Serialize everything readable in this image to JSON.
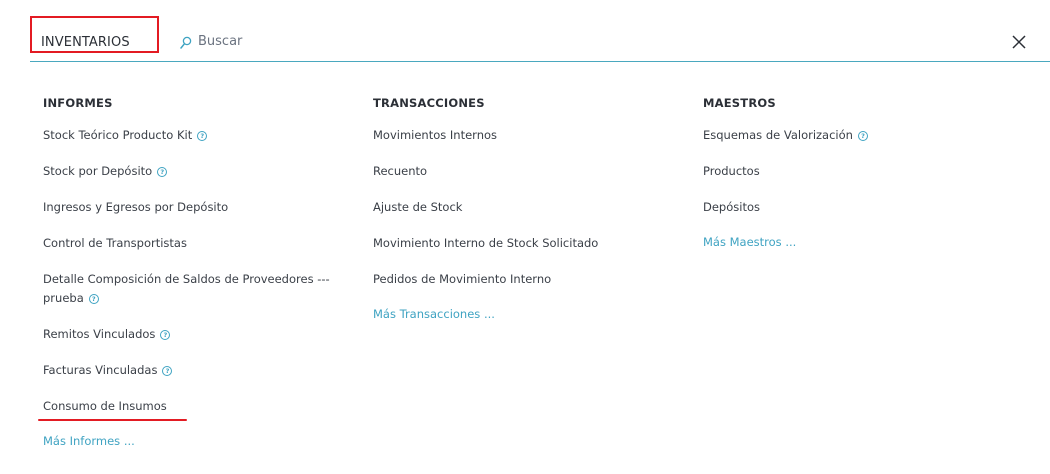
{
  "header": {
    "module_title": "INVENTARIOS",
    "search_placeholder": "Buscar",
    "icons": {
      "search": "search-icon",
      "close": "close-icon"
    }
  },
  "columns": [
    {
      "title": "INFORMES",
      "items": [
        {
          "label": "Stock Teórico Producto Kit",
          "help": true
        },
        {
          "label": "Stock por Depósito",
          "help": true
        },
        {
          "label": "Ingresos y Egresos por Depósito",
          "help": false
        },
        {
          "label": "Control de Transportistas",
          "help": false
        },
        {
          "label": "Detalle Composición de Saldos de Proveedores --- prueba",
          "help": true
        },
        {
          "label": "Remitos Vinculados",
          "help": true
        },
        {
          "label": "Facturas Vinculadas",
          "help": true
        },
        {
          "label": "Consumo de Insumos",
          "help": false
        }
      ],
      "more": "Más Informes ..."
    },
    {
      "title": "TRANSACCIONES",
      "items": [
        {
          "label": "Movimientos Internos",
          "help": false
        },
        {
          "label": "Recuento",
          "help": false
        },
        {
          "label": "Ajuste de Stock",
          "help": false
        },
        {
          "label": "Movimiento Interno de Stock Solicitado",
          "help": false
        },
        {
          "label": "Pedidos de Movimiento Interno",
          "help": false
        }
      ],
      "more": "Más Transacciones ..."
    },
    {
      "title": "MAESTROS",
      "items": [
        {
          "label": "Esquemas de Valorización",
          "help": true
        },
        {
          "label": "Productos",
          "help": false
        },
        {
          "label": "Depósitos",
          "help": false
        }
      ],
      "more": "Más Maestros ..."
    }
  ],
  "colors": {
    "accent": "#3fa3c2",
    "highlight": "#e31b23",
    "text": "#3a3f47"
  }
}
